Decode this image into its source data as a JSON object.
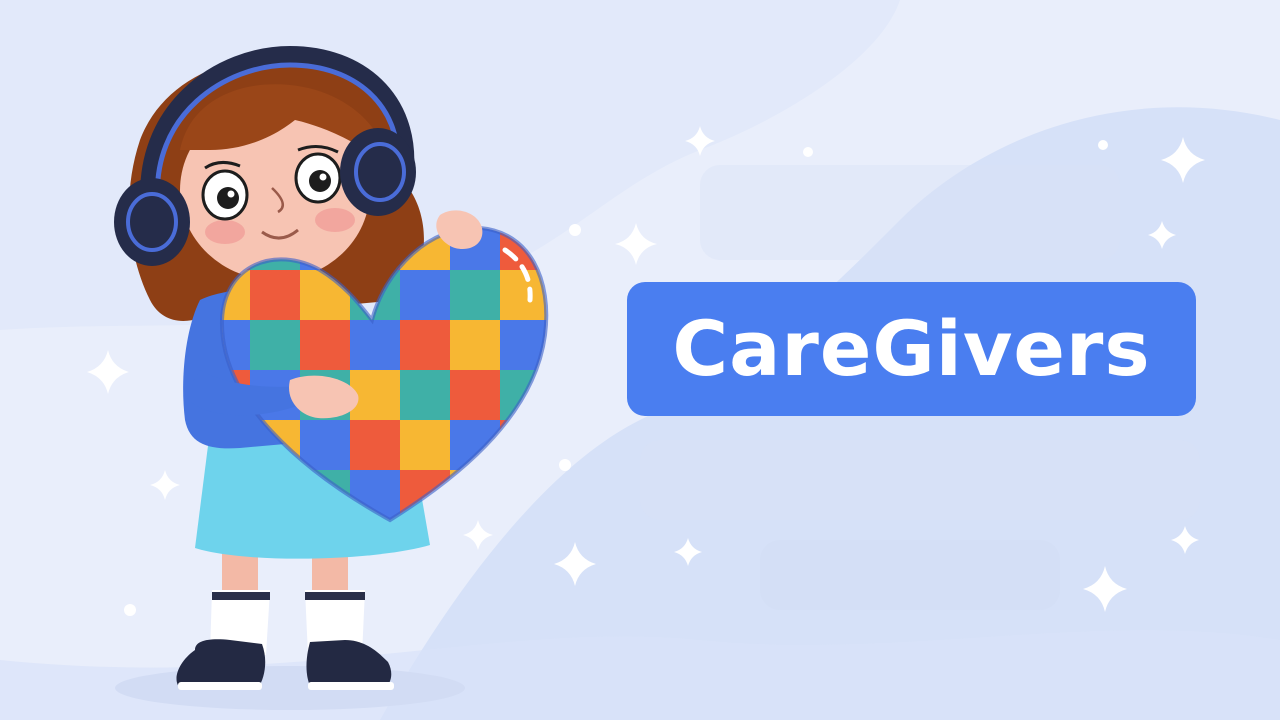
{
  "banner": {
    "title": "CareGivers"
  },
  "colors": {
    "background": "#e9eefb",
    "accent": "#4a7ef0",
    "title_text": "#ffffff",
    "puzzle_red": "#ee5b3c",
    "puzzle_blue": "#4a78e8",
    "puzzle_teal": "#3fb0a7",
    "puzzle_yellow": "#f7b733",
    "skirt": "#6ed3ec",
    "sweater": "#4574e0",
    "hair": "#8e3f15",
    "headphones": "#252c4a"
  },
  "icons": {
    "illustration": "girl-hugging-puzzle-heart",
    "sparkle": "sparkle-icon"
  }
}
